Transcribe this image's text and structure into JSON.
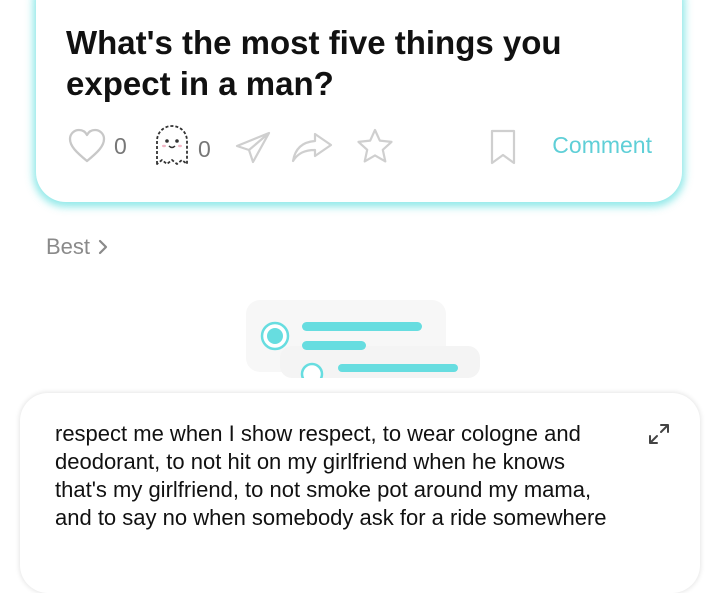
{
  "post": {
    "title": "What's the most five things you expect in a man?",
    "likes": "0",
    "ghosts": "0",
    "comment_label": "Comment"
  },
  "sort": {
    "label": "Best"
  },
  "answer": {
    "text": "respect me when I show respect, to wear cologne and deodorant, to not hit on my girlfriend when he knows that's my girlfriend, to not smoke pot around my mama, and to say no when somebody ask for a ride somewhere"
  },
  "icons": {
    "like": "heart-outline-icon",
    "ghost": "ghost-icon",
    "send": "paper-plane-icon",
    "share": "share-arrow-icon",
    "favorite": "star-outline-icon",
    "save": "bookmark-outline-icon",
    "expand": "expand-icon"
  },
  "colors": {
    "accent": "#5fcfd7",
    "card_glow": "#6ee1e1",
    "text": "#111111",
    "muted": "#8a8a8a"
  }
}
